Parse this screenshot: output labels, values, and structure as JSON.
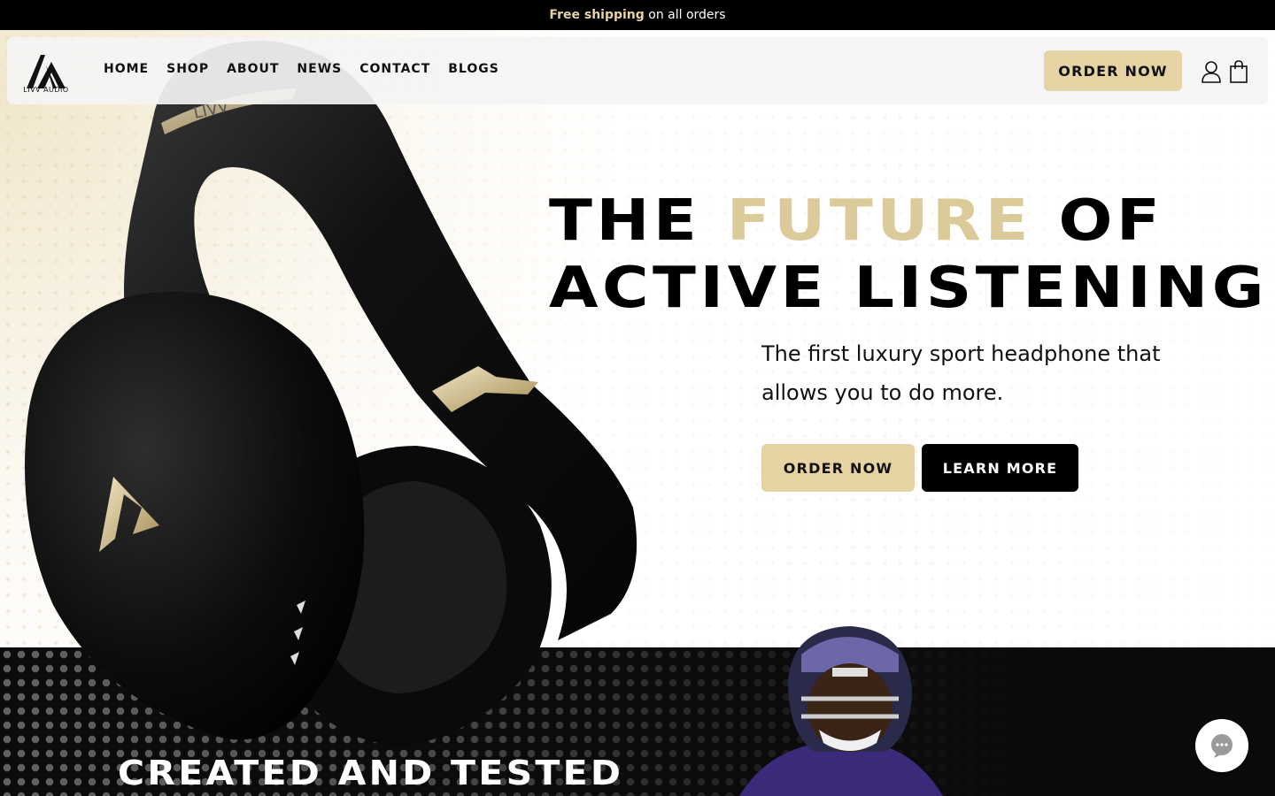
{
  "announcement": {
    "highlight": "Free shipping",
    "rest": " on all orders"
  },
  "brand": {
    "name": "LIVV AUDIO"
  },
  "nav": {
    "items": [
      "HOME",
      "SHOP",
      "ABOUT",
      "NEWS",
      "CONTACT",
      "BLOGS"
    ],
    "order_label": "ORDER NOW"
  },
  "hero": {
    "headline_part1": "THE ",
    "headline_highlight": "FUTURE",
    "headline_part2": " OF",
    "headline_line2": "ACTIVE LISTENING",
    "subtitle": "The first luxury sport headphone that allows you to do more.",
    "order_button": "ORDER NOW",
    "learn_button": "LEARN MORE",
    "headband_text": "LIVV"
  },
  "section2": {
    "title": "CREATED AND TESTED"
  },
  "colors": {
    "accent": "#e6d3a3",
    "dark": "#000000",
    "headline_gold": "#dccb9a"
  },
  "icons": [
    "user-icon",
    "shopping-bag-icon",
    "chat-icon",
    "logo-icon"
  ]
}
